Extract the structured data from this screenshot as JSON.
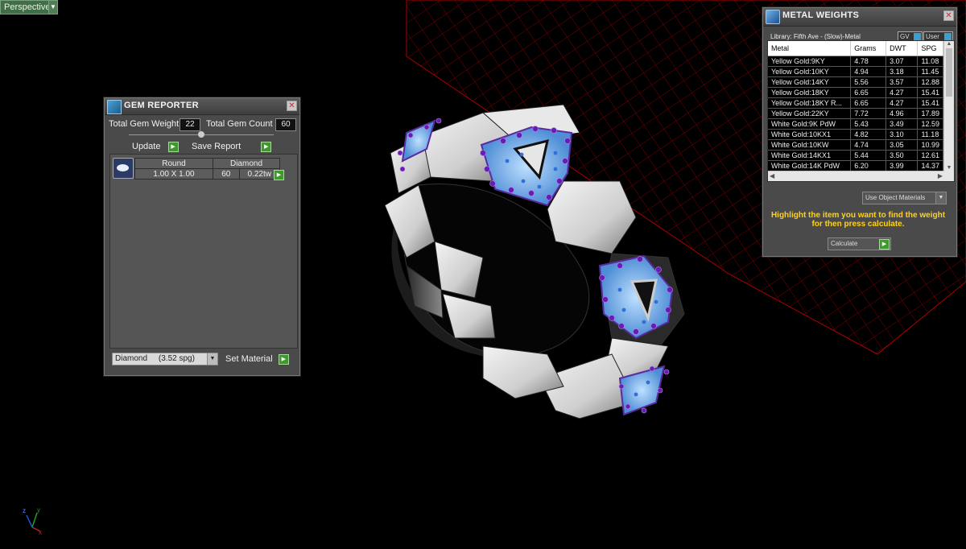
{
  "viewport": {
    "view_label": "Perspective"
  },
  "gem_reporter": {
    "title": "GEM REPORTER",
    "total_weight_label": "Total Gem Weight",
    "total_weight_value": "22",
    "total_count_label": "Total Gem Count",
    "total_count_value": "60",
    "update_label": "Update",
    "save_report_label": "Save Report",
    "row": {
      "shape": "Round",
      "type": "Diamond",
      "size": "1.00 X 1.00",
      "count": "60",
      "weight": "0.22tw"
    },
    "material_select": "Diamond     (3.52 spg)",
    "set_material_label": "Set Material"
  },
  "metal_weights": {
    "title": "METAL WEIGHTS",
    "library": "Library: Fifth Ave - (Slow)-Metal",
    "gv_label": "GV",
    "user_label": "User",
    "columns": [
      "Metal",
      "Grams",
      "DWT",
      "SPG"
    ],
    "rows": [
      [
        "Yellow Gold:9KY",
        "4.78",
        "3.07",
        "11.08"
      ],
      [
        "Yellow Gold:10KY",
        "4.94",
        "3.18",
        "11.45"
      ],
      [
        "Yellow Gold:14KY",
        "5.56",
        "3.57",
        "12.88"
      ],
      [
        "Yellow Gold:18KY",
        "6.65",
        "4.27",
        "15.41"
      ],
      [
        "Yellow Gold:18KY R...",
        "6.65",
        "4.27",
        "15.41"
      ],
      [
        "Yellow Gold:22KY",
        "7.72",
        "4.96",
        "17.89"
      ],
      [
        "White Gold:9K PdW",
        "5.43",
        "3.49",
        "12.59"
      ],
      [
        "White Gold:10KX1",
        "4.82",
        "3.10",
        "11.18"
      ],
      [
        "White Gold:10KW",
        "4.74",
        "3.05",
        "10.99"
      ],
      [
        "White Gold:14KX1",
        "5.44",
        "3.50",
        "12.61"
      ],
      [
        "White Gold:14K PdW",
        "6.20",
        "3.99",
        "14.37"
      ]
    ],
    "material_mode": "Use Object Materials",
    "hint_line1": "Highlight the item you want to find the weight",
    "hint_line2": "for then press calculate.",
    "calculate_label": "Calculate"
  },
  "axes": {
    "x": "x",
    "y": "y",
    "z": "z"
  },
  "colors": {
    "background": "#000000",
    "grid": "#8a0000",
    "metal": "#d9d9d9",
    "gem_blue": "#6ea8e6",
    "gem_purple": "#6a1bb5",
    "hint": "#ffd21a",
    "go_button": "#3d9b2c"
  }
}
